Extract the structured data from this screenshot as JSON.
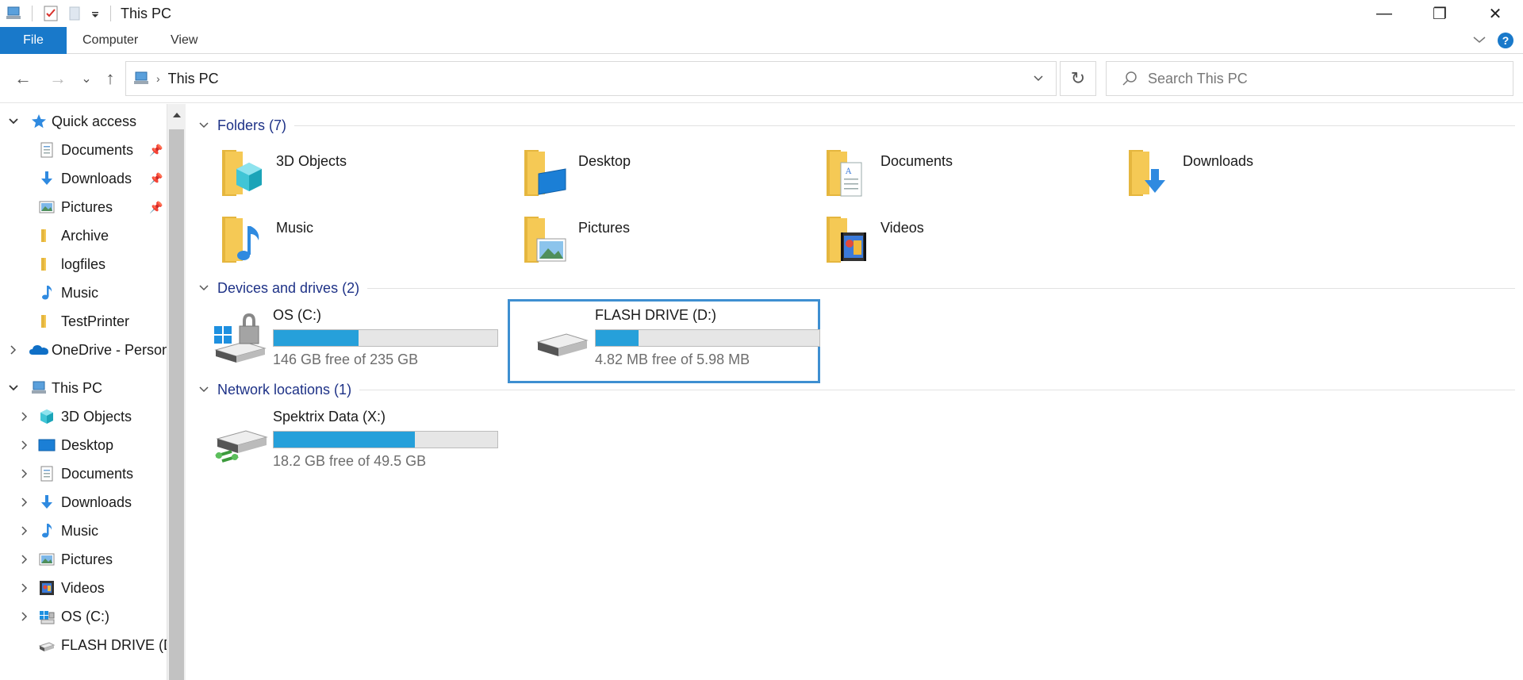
{
  "window": {
    "title": "This PC",
    "controls": {
      "minimize": "—",
      "maximize": "❐",
      "close": "✕"
    }
  },
  "ribbon": {
    "tabs": [
      "File",
      "Computer",
      "View"
    ],
    "help": "?"
  },
  "nav": {
    "back": "←",
    "forward": "→",
    "recent": "⌄",
    "up": "↑",
    "address": "This PC",
    "search_placeholder": "Search This PC"
  },
  "sidebar": {
    "items": [
      {
        "label": "Quick access",
        "icon": "star-icon",
        "level": 0,
        "expanded": true
      },
      {
        "label": "Documents",
        "icon": "documents-icon",
        "level": 1,
        "pinned": true
      },
      {
        "label": "Downloads",
        "icon": "downloads-icon",
        "level": 1,
        "pinned": true
      },
      {
        "label": "Pictures",
        "icon": "pictures-icon",
        "level": 1,
        "pinned": true
      },
      {
        "label": "Archive",
        "icon": "folder-icon",
        "level": 1
      },
      {
        "label": "logfiles",
        "icon": "folder-icon",
        "level": 1
      },
      {
        "label": "Music",
        "icon": "music-icon",
        "level": 1
      },
      {
        "label": "TestPrinter",
        "icon": "folder-icon",
        "level": 1
      },
      {
        "label": "OneDrive - Person",
        "icon": "onedrive-icon",
        "level": 0,
        "expanded": false
      },
      {
        "label": "This PC",
        "icon": "this-pc-icon",
        "level": 0,
        "expanded": true
      },
      {
        "label": "3D Objects",
        "icon": "3d-objects-icon",
        "level": 1
      },
      {
        "label": "Desktop",
        "icon": "desktop-icon",
        "level": 1
      },
      {
        "label": "Documents",
        "icon": "documents-icon",
        "level": 1
      },
      {
        "label": "Downloads",
        "icon": "downloads-icon",
        "level": 1
      },
      {
        "label": "Music",
        "icon": "music-icon",
        "level": 1
      },
      {
        "label": "Pictures",
        "icon": "pictures-icon",
        "level": 1
      },
      {
        "label": "Videos",
        "icon": "videos-icon",
        "level": 1
      },
      {
        "label": "OS (C:)",
        "icon": "os-drive-icon",
        "level": 1
      },
      {
        "label": "FLASH DRIVE (D",
        "icon": "flash-drive-icon",
        "level": 1
      }
    ]
  },
  "groups": {
    "folders": {
      "header": "Folders (7)",
      "items": [
        "3D Objects",
        "Desktop",
        "Documents",
        "Downloads",
        "Music",
        "Pictures",
        "Videos"
      ]
    },
    "devices": {
      "header": "Devices and drives (2)",
      "items": [
        {
          "name": "OS (C:)",
          "free": "146 GB free of 235 GB",
          "used_fraction": 0.38
        },
        {
          "name": "FLASH DRIVE (D:)",
          "free": "4.82 MB free of 5.98 MB",
          "used_fraction": 0.19,
          "selected": true
        }
      ]
    },
    "network": {
      "header": "Network locations (1)",
      "items": [
        {
          "name": "Spektrix Data (X:)",
          "free": "18.2 GB free of 49.5 GB",
          "used_fraction": 0.63
        }
      ]
    }
  },
  "colors": {
    "accent": "#1979ca",
    "bar_fill": "#26a0da",
    "group_header": "#1e3287",
    "selection_border": "#3e8fd1",
    "folder_yellow": "#f5c955"
  }
}
